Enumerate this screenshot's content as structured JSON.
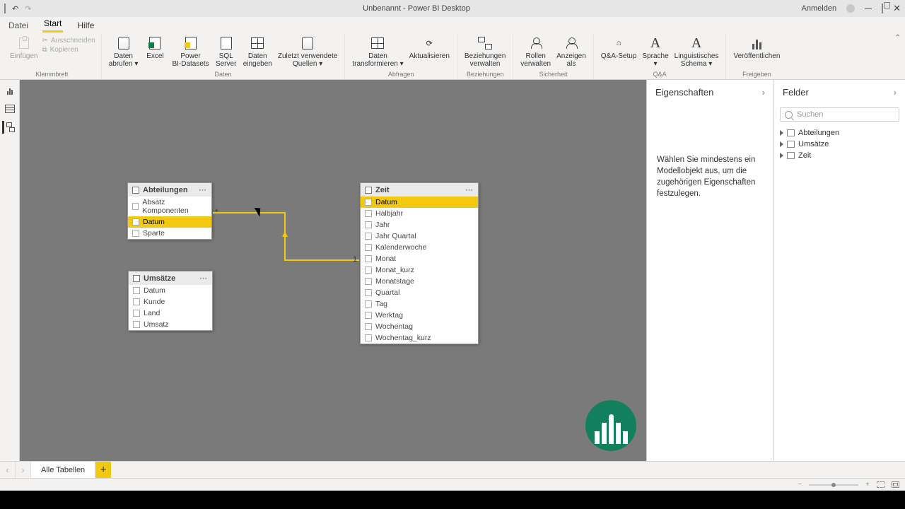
{
  "titlebar": {
    "title": "Unbenannt - Power BI Desktop",
    "signin": "Anmelden"
  },
  "menu": {
    "file": "Datei",
    "start": "Start",
    "help": "Hilfe"
  },
  "ribbon": {
    "groups": {
      "clipboard": "Klemmbrett",
      "data": "Daten",
      "queries": "Abfragen",
      "relationships": "Beziehungen",
      "security": "Sicherheit",
      "qa": "Q&A",
      "share": "Freigeben"
    },
    "paste": "Einfügen",
    "cut": "Ausschneiden",
    "copy": "Kopieren",
    "get_data": "Daten\nabrufen",
    "excel": "Excel",
    "pbi_ds": "Power\nBI-Datasets",
    "sql": "SQL\nServer",
    "enter": "Daten\neingeben",
    "recent": "Zuletzt verwendete\nQuellen",
    "transform": "Daten\ntransformieren",
    "refresh": "Aktualisieren",
    "manage_rel": "Beziehungen\nverwalten",
    "roles": "Rollen\nverwalten",
    "view_as": "Anzeigen\nals",
    "qa_setup": "Q&A-Setup",
    "lang": "Sprache\n",
    "ling": "Linguistisches\nSchema",
    "publish": "Veröffentlichen"
  },
  "tables": {
    "abteilungen": {
      "name": "Abteilungen",
      "fields": [
        "Absatz Komponenten",
        "Datum",
        "Sparte"
      ],
      "hl": 1
    },
    "umsaetze": {
      "name": "Umsätze",
      "fields": [
        "Datum",
        "Kunde",
        "Land",
        "Umsatz"
      ]
    },
    "zeit": {
      "name": "Zeit",
      "fields": [
        "Datum",
        "Halbjahr",
        "Jahr",
        "Jahr Quartal",
        "Kalenderwoche",
        "Monat",
        "Monat_kurz",
        "Monatstage",
        "Quartal",
        "Tag",
        "Werktag",
        "Wochentag",
        "Wochentag_kurz"
      ],
      "hl": 0
    }
  },
  "relation": {
    "many": "*",
    "one": "1"
  },
  "props": {
    "title": "Eigenschaften",
    "message": "Wählen Sie mindestens ein Modellobjekt aus, um die zugehörigen Eigenschaften festzulegen."
  },
  "fields": {
    "title": "Felder",
    "search_ph": "Suchen",
    "items": [
      "Abteilungen",
      "Umsätze",
      "Zeit"
    ]
  },
  "tabs": {
    "all": "Alle Tabellen"
  },
  "status": {
    "minus": "−",
    "plus": "+"
  }
}
